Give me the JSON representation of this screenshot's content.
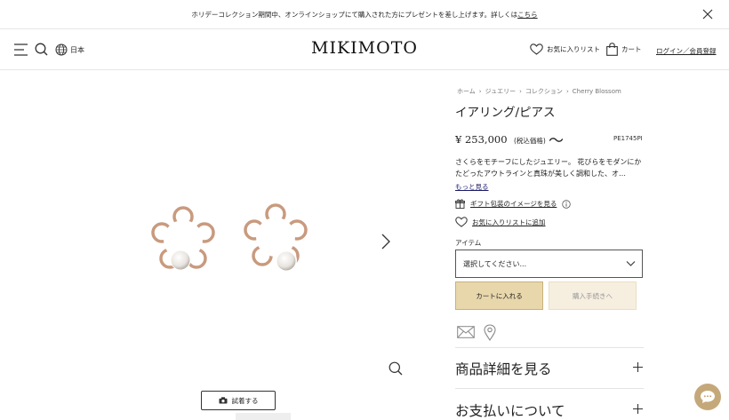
{
  "banner": {
    "text": "ホリデーコレクション期間中、オンラインショップにて購入された方にプレゼントを差し上げます。詳しくは",
    "link": "こちら"
  },
  "header": {
    "language": "日本",
    "logo": "MIKIMOTO",
    "favorites": "お気に入りリスト",
    "cart": "カート",
    "login": "ログイン／会員登録"
  },
  "gallery": {
    "try_on": "試着する"
  },
  "product": {
    "breadcrumb": [
      "ホーム",
      "ジュエリー",
      "コレクション",
      "Cherry Blossom"
    ],
    "title": "イアリング/ピアス",
    "price": "¥ 253,000",
    "tax_label": "(税込価格)",
    "tilde": "〜",
    "code": "PE1745PI",
    "description": "さくらをモチーフにしたジュエリー。 花びらをモダンにかたどったアウトラインと真珠が美しく調和した、オ…",
    "more": "もっと見る",
    "gift": "ギフト包装のイメージを見る",
    "wishlist": "お気に入りリストに追加",
    "item_label": "アイテム",
    "select_placeholder": "選択してください...",
    "add_to_cart": "カートに入れる",
    "checkout": "購入手続きへ"
  },
  "accordion": {
    "details": "商品詳細を見る",
    "payment": "お支払いについて"
  },
  "colors": {
    "accent_gold": "#e9d7ac",
    "chat_bubble": "#c5a87a"
  }
}
